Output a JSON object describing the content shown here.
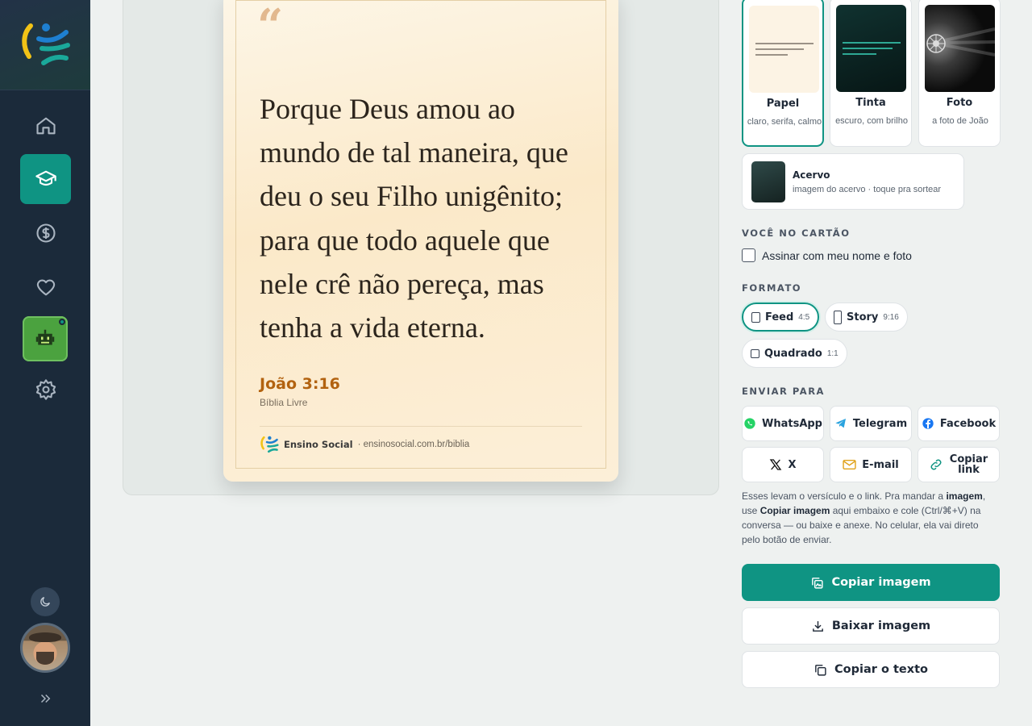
{
  "sidebar": {
    "nav": [
      {
        "icon": "home-icon",
        "active": false
      },
      {
        "icon": "graduation-cap-icon",
        "active": true
      },
      {
        "icon": "dollar-icon",
        "active": false
      },
      {
        "icon": "heart-icon",
        "active": false
      },
      {
        "icon": "robot-icon",
        "active": false
      },
      {
        "icon": "gear-icon",
        "active": false
      }
    ],
    "theme_icon": "moon-icon",
    "collapse_icon": "chevrons-right-icon"
  },
  "card": {
    "quote_mark": "“",
    "verse": "Porque Deus amou ao mundo de tal maneira, que deu o seu Filho unigênito; para que todo aquele que nele crê não pereça, mas tenha a vida eterna.",
    "reference": "João 3:16",
    "version": "Bíblia Livre",
    "brand": "Ensino Social",
    "site": "· ensinosocial.com.br/biblia"
  },
  "styles": [
    {
      "name": "Papel",
      "desc": "claro, serifa, calmo",
      "selected": true
    },
    {
      "name": "Tinta",
      "desc": "escuro, com brilho",
      "selected": false
    },
    {
      "name": "Foto",
      "desc": "a foto de João",
      "selected": false
    }
  ],
  "acervo": {
    "name": "Acervo",
    "desc": "imagem do acervo · toque pra sortear"
  },
  "you_section": {
    "title": "VOCÊ NO CARTÃO",
    "sign_label": "Assinar com meu nome e foto",
    "checked": false
  },
  "format_section": {
    "title": "FORMATO",
    "options": [
      {
        "label": "Feed",
        "ratio": "4:5",
        "selected": true
      },
      {
        "label": "Story",
        "ratio": "9:16",
        "selected": false
      },
      {
        "label": "Quadrado",
        "ratio": "1:1",
        "selected": false
      }
    ]
  },
  "send_section": {
    "title": "ENVIAR PARA",
    "targets": [
      {
        "label": "WhatsApp",
        "icon": "whatsapp-icon",
        "color": "#25d366"
      },
      {
        "label": "Telegram",
        "icon": "telegram-icon",
        "color": "#2aa3df"
      },
      {
        "label": "Facebook",
        "icon": "facebook-icon",
        "color": "#1877f2"
      },
      {
        "label": "X",
        "icon": "x-icon",
        "color": "#111111"
      },
      {
        "label": "E-mail",
        "icon": "mail-icon",
        "color": "#e0a21b"
      },
      {
        "label": "Copiar link",
        "icon": "link-icon",
        "color": "#0f9483"
      }
    ]
  },
  "hint": {
    "part1": "Esses levam o versículo e o link. Pra mandar a ",
    "bold1": "imagem",
    "part2": ", use ",
    "bold2": "Copiar imagem",
    "part3": " aqui embaixo e cole (Ctrl/⌘+V) na conversa — ou baixe e anexe. No celular, ela vai direto pelo botão de enviar."
  },
  "actions": {
    "copy_image": "Copiar imagem",
    "download_image": "Baixar imagem",
    "copy_text": "Copiar o texto"
  },
  "colors": {
    "accent": "#0f9483",
    "sidebar": "#1b2a3a",
    "reference": "#b2620f"
  }
}
